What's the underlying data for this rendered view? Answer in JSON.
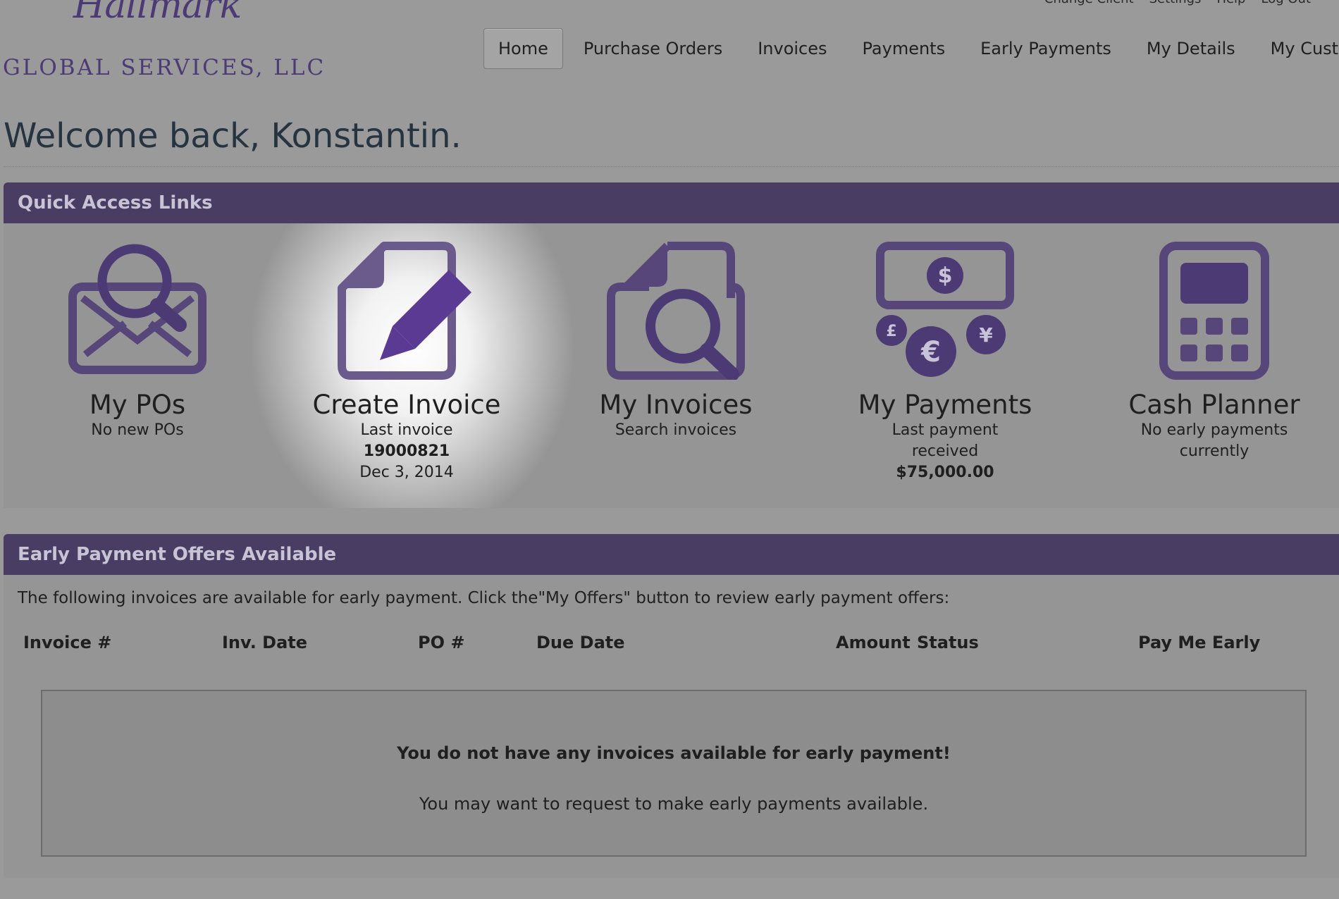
{
  "utility_links": [
    "Change Client",
    "Settings",
    "Help",
    "Log Out"
  ],
  "logo": {
    "script": "Hallmark",
    "subtitle": "GLOBAL SERVICES, LLC"
  },
  "nav": {
    "items": [
      "Home",
      "Purchase Orders",
      "Invoices",
      "Payments",
      "Early Payments",
      "My Details",
      "My Customer"
    ],
    "active": "Home"
  },
  "welcome": "Welcome back, Konstantin.",
  "quick_access": {
    "title": "Quick Access Links",
    "tiles": [
      {
        "title": "My POs",
        "lines": [
          "No new POs"
        ],
        "icon": "envelope-search-icon"
      },
      {
        "title": "Create Invoice",
        "lines": [
          "Last invoice",
          "19000821",
          "Dec 3, 2014"
        ],
        "icon": "document-pencil-icon"
      },
      {
        "title": "My Invoices",
        "lines": [
          "Search invoices"
        ],
        "icon": "document-search-icon"
      },
      {
        "title": "My Payments",
        "lines": [
          "Last payment",
          "received",
          "$75,000.00"
        ],
        "icon": "currency-icon"
      },
      {
        "title": "Cash Planner",
        "lines": [
          "No early payments",
          "currently"
        ],
        "icon": "calculator-icon"
      }
    ]
  },
  "early_payment": {
    "title": "Early Payment Offers Available",
    "intro": "The following invoices are available for early payment. Click the\"My Offers\" button to review early payment offers:",
    "columns": [
      "Invoice #",
      "Inv. Date",
      "PO #",
      "Due Date",
      "Amount",
      "Status",
      "Pay Me Early"
    ],
    "empty_title": "You do not have any invoices available for early payment!",
    "empty_sub": "You may want to request to make early payments available."
  },
  "colors": {
    "accent": "#4a3d63",
    "icon": "#4c3a75",
    "background": "#9a9a9a"
  }
}
